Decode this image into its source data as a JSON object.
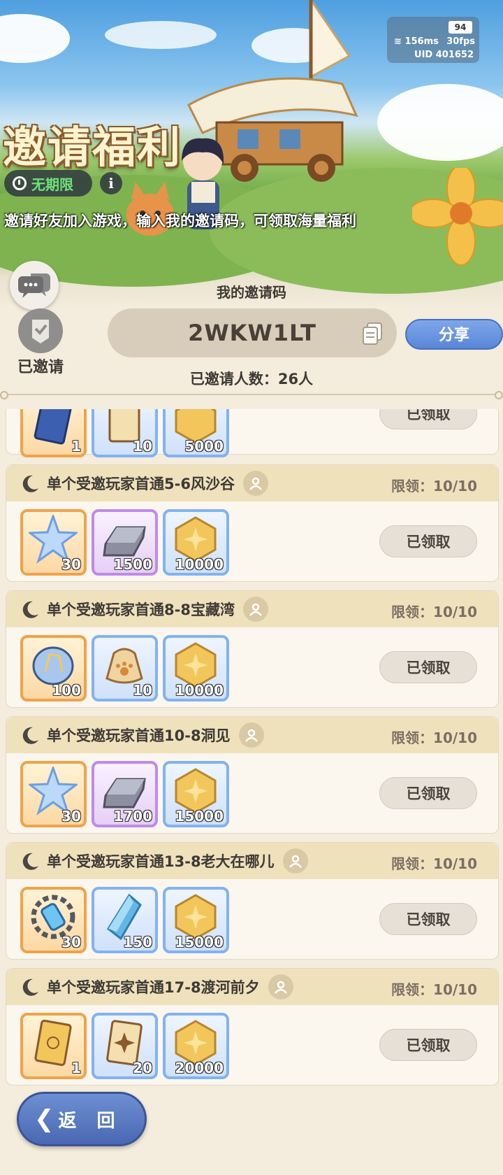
{
  "status": {
    "battery": "94",
    "ping": "156ms",
    "fps": "30fps",
    "uid": "UID 401652"
  },
  "banner": {
    "title": "邀请福利",
    "duration": "无期限",
    "info_icon": "i",
    "subtitle": "邀请好友加入游戏，输入我的邀请码，可领取海量福利"
  },
  "invite": {
    "code_title": "我的邀请码",
    "code": "2WKW1LT",
    "share_label": "分享",
    "invited_label": "已邀请",
    "count_text": "已邀请人数：26人"
  },
  "cards": [
    {
      "title": "",
      "limit": "",
      "claim_label": "已领取",
      "items": [
        {
          "icon": "blue-card-icon",
          "qty": "1",
          "rarity": "orange"
        },
        {
          "icon": "gold-card-icon",
          "qty": "10",
          "rarity": "blue"
        },
        {
          "icon": "gold-coin-icon",
          "qty": "5000",
          "rarity": "blue"
        }
      ]
    },
    {
      "title": "单个受邀玩家首通5-6风沙谷",
      "limit": "限领：10/10",
      "claim_label": "已领取",
      "items": [
        {
          "icon": "star-crystal-icon",
          "qty": "30",
          "rarity": "orange"
        },
        {
          "icon": "iron-ingot-icon",
          "qty": "1500",
          "rarity": "purple"
        },
        {
          "icon": "gold-coin-icon",
          "qty": "10000",
          "rarity": "blue"
        }
      ]
    },
    {
      "title": "单个受邀玩家首通8-8宝藏湾",
      "limit": "限领：10/10",
      "claim_label": "已领取",
      "items": [
        {
          "icon": "crystal-orb-icon",
          "qty": "100",
          "rarity": "orange"
        },
        {
          "icon": "paw-sack-icon",
          "qty": "10",
          "rarity": "blue"
        },
        {
          "icon": "gold-coin-icon",
          "qty": "10000",
          "rarity": "blue"
        }
      ]
    },
    {
      "title": "单个受邀玩家首通10-8洞见",
      "limit": "限领：10/10",
      "claim_label": "已领取",
      "items": [
        {
          "icon": "star-crystal-icon",
          "qty": "30",
          "rarity": "orange"
        },
        {
          "icon": "iron-ingot-icon",
          "qty": "1700",
          "rarity": "purple"
        },
        {
          "icon": "gold-coin-icon",
          "qty": "15000",
          "rarity": "blue"
        }
      ]
    },
    {
      "title": "单个受邀玩家首通13-8老大在哪儿",
      "limit": "限领：10/10",
      "claim_label": "已领取",
      "items": [
        {
          "icon": "gear-capsule-icon",
          "qty": "30",
          "rarity": "orange"
        },
        {
          "icon": "blue-gem-icon",
          "qty": "150",
          "rarity": "blue"
        },
        {
          "icon": "gold-coin-icon",
          "qty": "15000",
          "rarity": "blue"
        }
      ]
    },
    {
      "title": "单个受邀玩家首通17-8渡河前夕",
      "limit": "限领：10/10",
      "claim_label": "已领取",
      "items": [
        {
          "icon": "gold-card-icon",
          "qty": "1",
          "rarity": "orange"
        },
        {
          "icon": "sparkle-card-icon",
          "qty": "20",
          "rarity": "blue"
        },
        {
          "icon": "gold-coin-icon",
          "qty": "20000",
          "rarity": "blue"
        }
      ]
    }
  ],
  "back": {
    "label": "返 回"
  }
}
